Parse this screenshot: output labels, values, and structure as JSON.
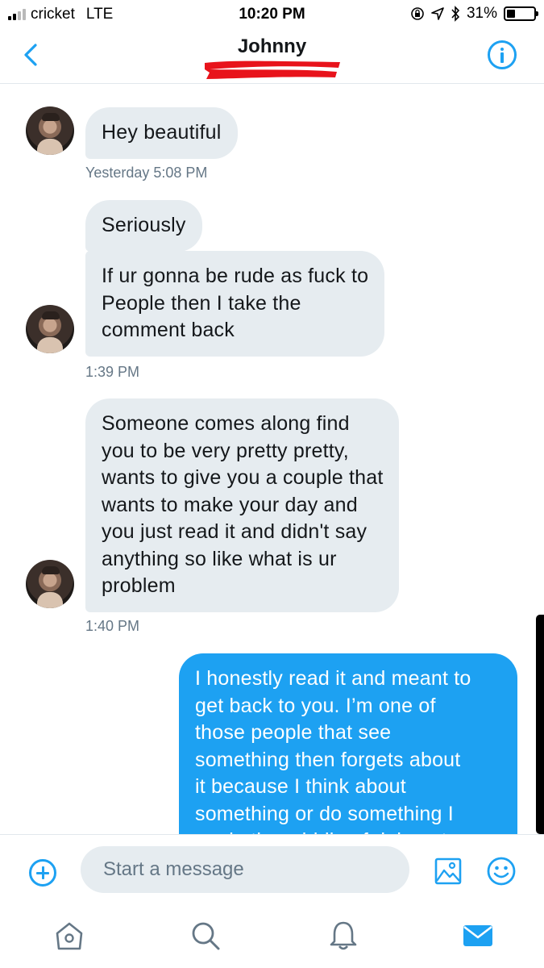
{
  "status_bar": {
    "carrier": "cricket",
    "network": "LTE",
    "time": "10:20 PM",
    "battery_percent": "31%",
    "battery_level": 0.31,
    "signal_bars": 2
  },
  "header": {
    "title": "Johnny",
    "back_icon": "chevron-left-icon",
    "info_icon": "info-icon",
    "accent_color": "#1da1f2"
  },
  "messages": [
    {
      "sender": "them",
      "text": "Hey beautiful"
    },
    {
      "timestamp": "Yesterday 5:08 PM"
    },
    {
      "sender": "them",
      "text": "Seriously"
    },
    {
      "sender": "them",
      "text": "If ur gonna be rude as fuck to\nPeople then I take the\ncomment back"
    },
    {
      "timestamp": "1:39 PM"
    },
    {
      "sender": "them",
      "text": "Someone comes along find\nyou to be very pretty pretty,\nwants to give you a couple that\nwants to make your day and\nyou just read it and didn't say\nanything so like what is ur\nproblem"
    },
    {
      "timestamp": "1:40 PM"
    },
    {
      "sender": "me",
      "text": "I honestly read it and meant to\nget back to you. I’m one of\nthose people that see\nsomething then forgets about\nit because I think about\nsomething or do something I\nam in the middle of doing at"
    }
  ],
  "colors": {
    "incoming_bubble": "#e6ecf0",
    "outgoing_bubble": "#1da1f2",
    "timestamp": "#657786"
  },
  "composer": {
    "placeholder": "Start a message",
    "add_icon": "plus-circle-icon",
    "image_icon": "image-icon",
    "emoji_icon": "smiley-icon"
  },
  "tabs": [
    {
      "name": "home",
      "icon": "home-icon",
      "active": false
    },
    {
      "name": "search",
      "icon": "search-icon",
      "active": false
    },
    {
      "name": "notifications",
      "icon": "bell-icon",
      "active": false
    },
    {
      "name": "messages",
      "icon": "mail-icon",
      "active": true
    }
  ]
}
